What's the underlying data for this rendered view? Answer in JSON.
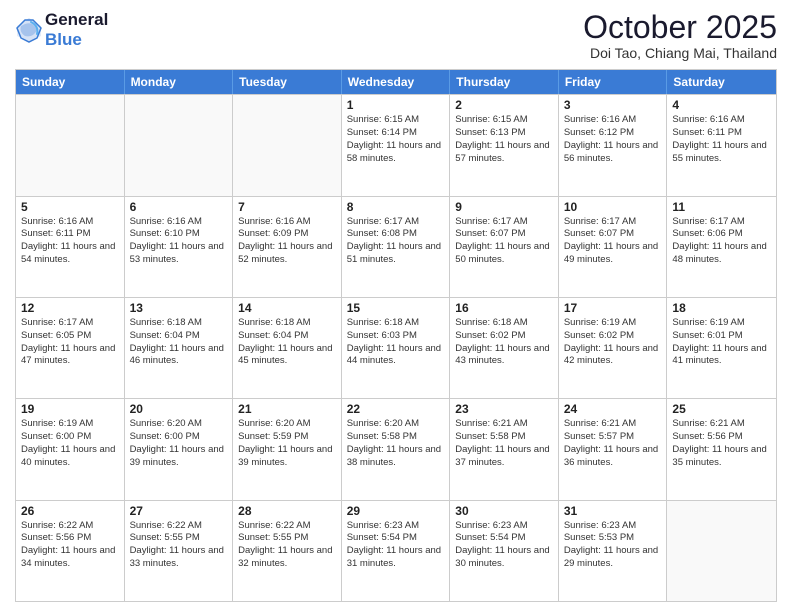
{
  "header": {
    "logo_line1": "General",
    "logo_line2": "Blue",
    "month_title": "October 2025",
    "location": "Doi Tao, Chiang Mai, Thailand"
  },
  "weekdays": [
    "Sunday",
    "Monday",
    "Tuesday",
    "Wednesday",
    "Thursday",
    "Friday",
    "Saturday"
  ],
  "rows": [
    [
      {
        "day": "",
        "empty": true
      },
      {
        "day": "",
        "empty": true
      },
      {
        "day": "",
        "empty": true
      },
      {
        "day": "1",
        "sunrise": "6:15 AM",
        "sunset": "6:14 PM",
        "daylight": "11 hours and 58 minutes."
      },
      {
        "day": "2",
        "sunrise": "6:15 AM",
        "sunset": "6:13 PM",
        "daylight": "11 hours and 57 minutes."
      },
      {
        "day": "3",
        "sunrise": "6:16 AM",
        "sunset": "6:12 PM",
        "daylight": "11 hours and 56 minutes."
      },
      {
        "day": "4",
        "sunrise": "6:16 AM",
        "sunset": "6:11 PM",
        "daylight": "11 hours and 55 minutes."
      }
    ],
    [
      {
        "day": "5",
        "sunrise": "6:16 AM",
        "sunset": "6:11 PM",
        "daylight": "11 hours and 54 minutes."
      },
      {
        "day": "6",
        "sunrise": "6:16 AM",
        "sunset": "6:10 PM",
        "daylight": "11 hours and 53 minutes."
      },
      {
        "day": "7",
        "sunrise": "6:16 AM",
        "sunset": "6:09 PM",
        "daylight": "11 hours and 52 minutes."
      },
      {
        "day": "8",
        "sunrise": "6:17 AM",
        "sunset": "6:08 PM",
        "daylight": "11 hours and 51 minutes."
      },
      {
        "day": "9",
        "sunrise": "6:17 AM",
        "sunset": "6:07 PM",
        "daylight": "11 hours and 50 minutes."
      },
      {
        "day": "10",
        "sunrise": "6:17 AM",
        "sunset": "6:07 PM",
        "daylight": "11 hours and 49 minutes."
      },
      {
        "day": "11",
        "sunrise": "6:17 AM",
        "sunset": "6:06 PM",
        "daylight": "11 hours and 48 minutes."
      }
    ],
    [
      {
        "day": "12",
        "sunrise": "6:17 AM",
        "sunset": "6:05 PM",
        "daylight": "11 hours and 47 minutes."
      },
      {
        "day": "13",
        "sunrise": "6:18 AM",
        "sunset": "6:04 PM",
        "daylight": "11 hours and 46 minutes."
      },
      {
        "day": "14",
        "sunrise": "6:18 AM",
        "sunset": "6:04 PM",
        "daylight": "11 hours and 45 minutes."
      },
      {
        "day": "15",
        "sunrise": "6:18 AM",
        "sunset": "6:03 PM",
        "daylight": "11 hours and 44 minutes."
      },
      {
        "day": "16",
        "sunrise": "6:18 AM",
        "sunset": "6:02 PM",
        "daylight": "11 hours and 43 minutes."
      },
      {
        "day": "17",
        "sunrise": "6:19 AM",
        "sunset": "6:02 PM",
        "daylight": "11 hours and 42 minutes."
      },
      {
        "day": "18",
        "sunrise": "6:19 AM",
        "sunset": "6:01 PM",
        "daylight": "11 hours and 41 minutes."
      }
    ],
    [
      {
        "day": "19",
        "sunrise": "6:19 AM",
        "sunset": "6:00 PM",
        "daylight": "11 hours and 40 minutes."
      },
      {
        "day": "20",
        "sunrise": "6:20 AM",
        "sunset": "6:00 PM",
        "daylight": "11 hours and 39 minutes."
      },
      {
        "day": "21",
        "sunrise": "6:20 AM",
        "sunset": "5:59 PM",
        "daylight": "11 hours and 39 minutes."
      },
      {
        "day": "22",
        "sunrise": "6:20 AM",
        "sunset": "5:58 PM",
        "daylight": "11 hours and 38 minutes."
      },
      {
        "day": "23",
        "sunrise": "6:21 AM",
        "sunset": "5:58 PM",
        "daylight": "11 hours and 37 minutes."
      },
      {
        "day": "24",
        "sunrise": "6:21 AM",
        "sunset": "5:57 PM",
        "daylight": "11 hours and 36 minutes."
      },
      {
        "day": "25",
        "sunrise": "6:21 AM",
        "sunset": "5:56 PM",
        "daylight": "11 hours and 35 minutes."
      }
    ],
    [
      {
        "day": "26",
        "sunrise": "6:22 AM",
        "sunset": "5:56 PM",
        "daylight": "11 hours and 34 minutes."
      },
      {
        "day": "27",
        "sunrise": "6:22 AM",
        "sunset": "5:55 PM",
        "daylight": "11 hours and 33 minutes."
      },
      {
        "day": "28",
        "sunrise": "6:22 AM",
        "sunset": "5:55 PM",
        "daylight": "11 hours and 32 minutes."
      },
      {
        "day": "29",
        "sunrise": "6:23 AM",
        "sunset": "5:54 PM",
        "daylight": "11 hours and 31 minutes."
      },
      {
        "day": "30",
        "sunrise": "6:23 AM",
        "sunset": "5:54 PM",
        "daylight": "11 hours and 30 minutes."
      },
      {
        "day": "31",
        "sunrise": "6:23 AM",
        "sunset": "5:53 PM",
        "daylight": "11 hours and 29 minutes."
      },
      {
        "day": "",
        "empty": true
      }
    ]
  ]
}
